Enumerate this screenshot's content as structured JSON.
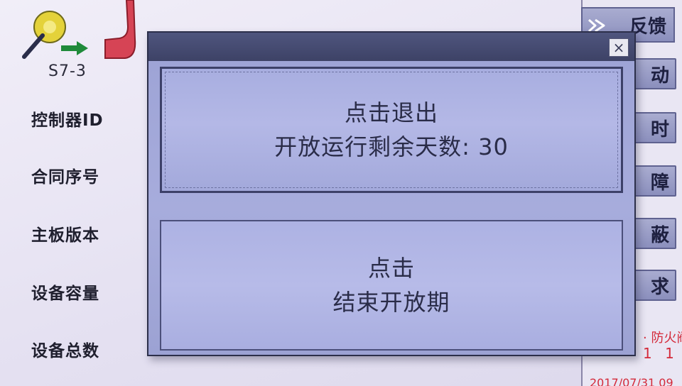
{
  "device": {
    "code": "S7-3"
  },
  "info_labels": {
    "controller_id": "控制器ID",
    "contract_no": "合同序号",
    "board_version": "主板版本",
    "device_capacity": "设备容量",
    "device_total": "设备总数"
  },
  "menu": {
    "feedback": "反馈",
    "item2": "动",
    "item3": "时",
    "item4": "障",
    "item5": "蔽",
    "item6": "求"
  },
  "status": {
    "fire_text": "· 防火阀",
    "fire_count": "1 1",
    "date_text": "2017/07/31 09"
  },
  "dialog": {
    "close_symbol": "×",
    "exit_button": {
      "line1": "点击退出",
      "line2": "开放运行剩余天数: 30"
    },
    "end_button": {
      "line1": "点击",
      "line2": "结束开放期"
    }
  },
  "colors": {
    "dialog_frame": "#5e6598",
    "dialog_button": "#a8aee0",
    "menu_button": "#9a9dc7",
    "alert_red": "#d42a3a"
  }
}
